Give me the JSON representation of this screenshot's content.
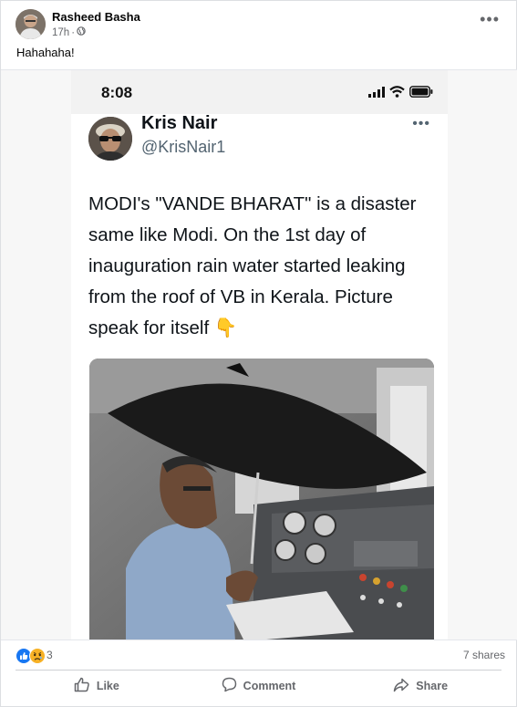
{
  "post": {
    "author": "Rasheed Basha",
    "time": "17h",
    "audience_icon": "globe-icon",
    "caption": "Hahahaha!",
    "menu_icon": "more-horizontal-icon"
  },
  "embed": {
    "status_time": "8:08",
    "tweet": {
      "name": "Kris Nair",
      "handle": "@KrisNair1",
      "text": "MODI's \"VANDE BHARAT\" is a disaster same like Modi. On the 1st day of inauguration rain water started leaking from the roof of VB in Kerala. Picture speak for itself 👇",
      "menu_icon": "more-horizontal-icon"
    },
    "media_icon": "train-cab-umbrella-photo"
  },
  "reactions": {
    "icons": [
      "like-reaction-icon",
      "sad-reaction-icon"
    ],
    "count": "3",
    "shares": "7 shares"
  },
  "actions": {
    "like": "Like",
    "comment": "Comment",
    "share": "Share"
  },
  "colors": {
    "text_primary": "#050505",
    "text_secondary": "#65676b",
    "like_blue": "#1877f2",
    "sad_yellow": "#f7b125"
  }
}
